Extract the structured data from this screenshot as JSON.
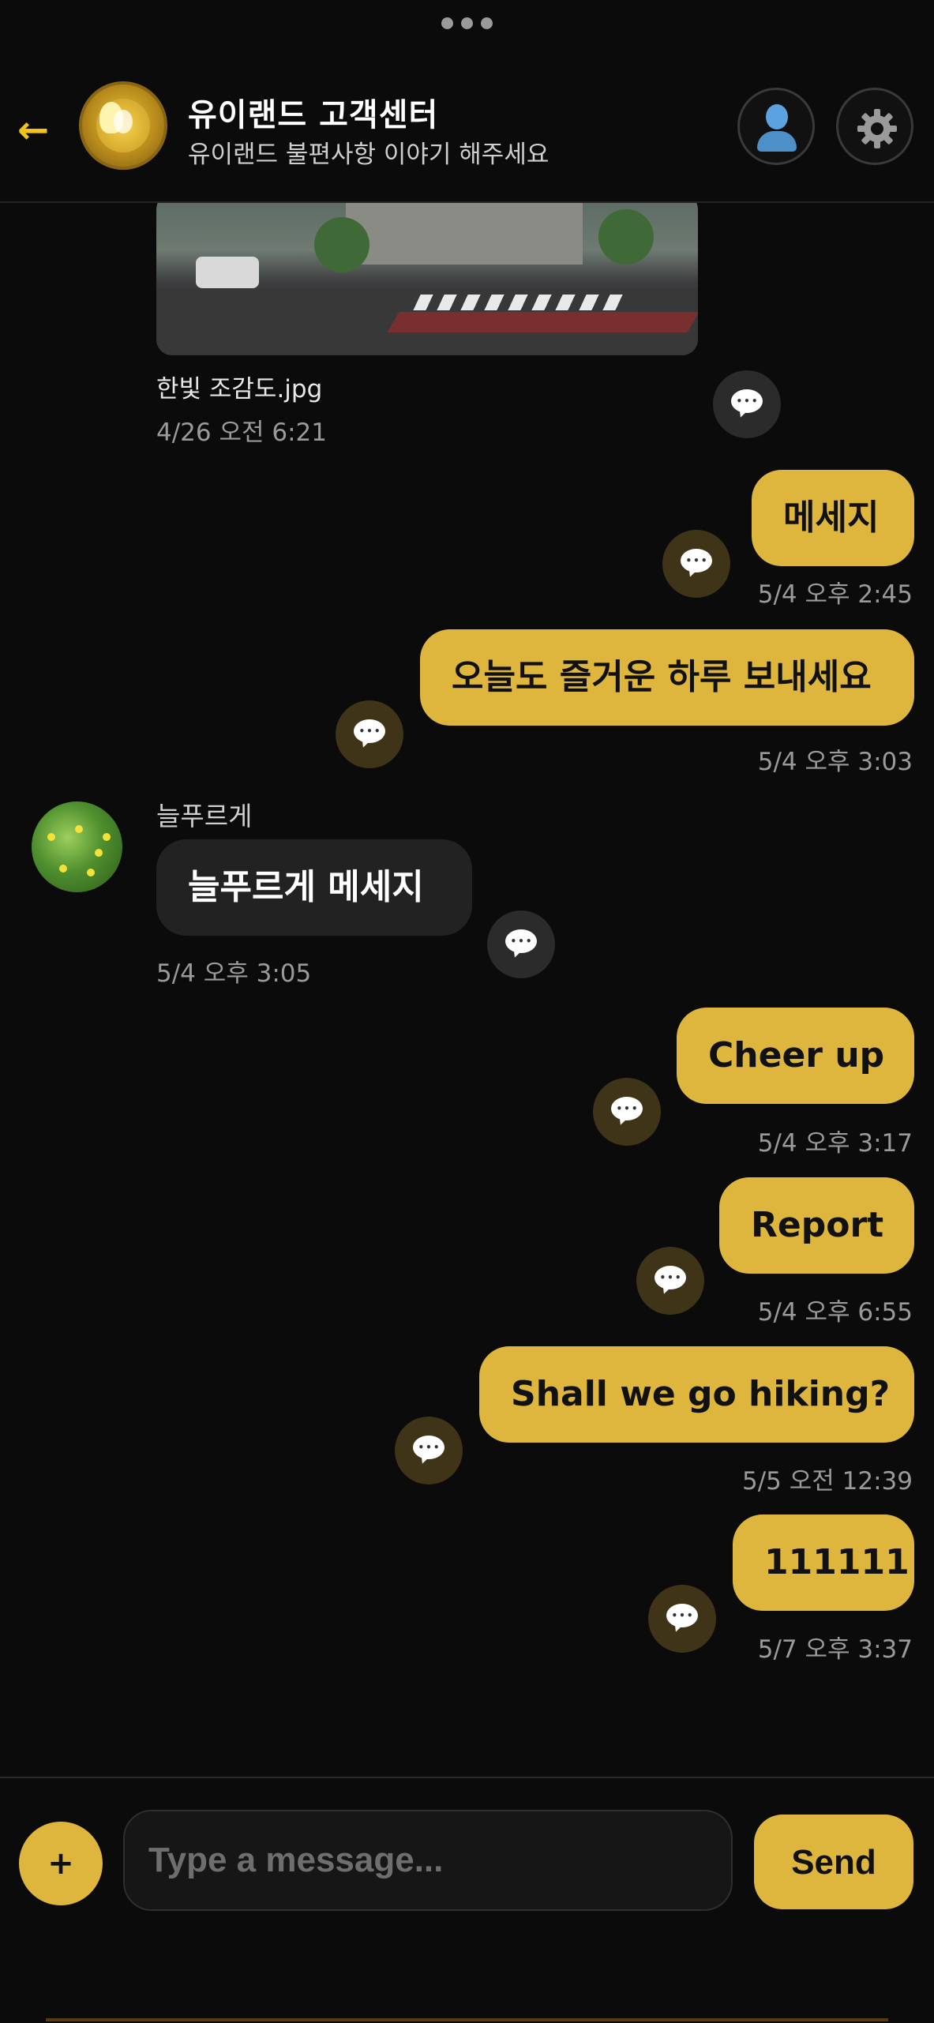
{
  "header": {
    "title": "유이랜드 고객센터",
    "subtitle": "유이랜드 불편사항 이야기 해주세요",
    "back_icon": "arrow-left-icon",
    "profile_icon": "user-icon",
    "settings_icon": "gear-icon"
  },
  "colors": {
    "accent": "#dfb63d",
    "background": "#0b0b0b",
    "bubble_other": "#222222"
  },
  "messages": [
    {
      "type": "image",
      "filename": "한빛 조감도.jpg",
      "time": "4/26 오전 6:21",
      "side": "left"
    },
    {
      "type": "text",
      "text": "메세지",
      "time": "5/4 오후 2:45",
      "side": "right"
    },
    {
      "type": "text",
      "text": "오늘도 즐거운 하루 보내세요",
      "time": "5/4 오후 3:03",
      "side": "right"
    },
    {
      "type": "text",
      "sender": "늘푸르게",
      "text": "늘푸르게  메세지",
      "time": "5/4 오후 3:05",
      "side": "left"
    },
    {
      "type": "text",
      "text": "Cheer up",
      "time": "5/4 오후 3:17",
      "side": "right"
    },
    {
      "type": "text",
      "text": "Report",
      "time": "5/4 오후 6:55",
      "side": "right"
    },
    {
      "type": "text",
      "text": "Shall we go hiking?",
      "time": "5/5 오전 12:39",
      "side": "right"
    },
    {
      "type": "text",
      "text": "111111",
      "time": "5/7 오후 3:37",
      "side": "right"
    }
  ],
  "composer": {
    "plus_label": "+",
    "placeholder": "Type a message...",
    "send_label": "Send"
  }
}
